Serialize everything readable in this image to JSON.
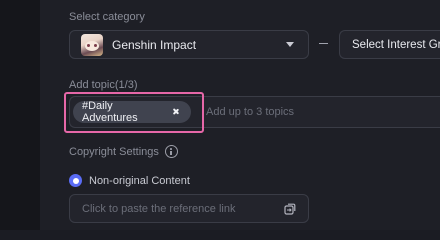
{
  "category": {
    "label": "Select category",
    "game": {
      "name": "Genshin Impact",
      "avatar_icon": "genshin-character-avatar"
    },
    "interest": {
      "placeholder": "Select Interest Group"
    }
  },
  "topic": {
    "label": "Add topic(1/3)",
    "chips": [
      {
        "label": "#Daily Adventures",
        "remove_icon": "close-icon"
      }
    ],
    "placeholder": "Add up to 3 topics",
    "highlight_color": "#e667a8"
  },
  "copyright": {
    "label": "Copyright Settings",
    "info_icon": "info-icon",
    "option_selected": "Non-original Content",
    "reference_placeholder": "Click to paste the reference link",
    "paste_icon": "paste-icon"
  },
  "colors": {
    "accent": "#5a6cf5",
    "background": "#1e1f26"
  }
}
